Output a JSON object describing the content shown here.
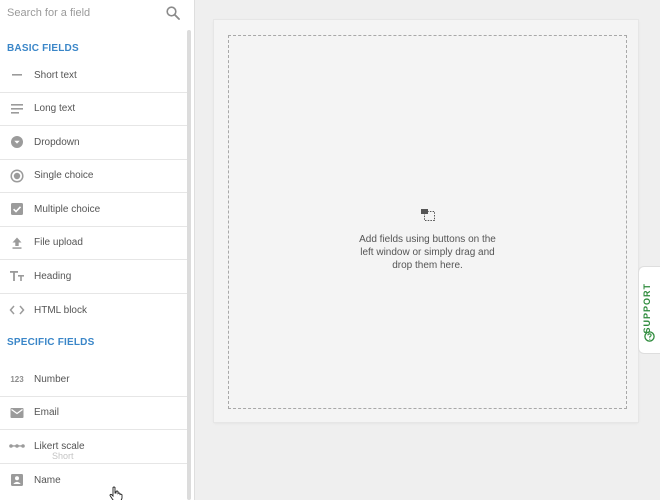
{
  "search": {
    "placeholder": "Search for a field",
    "icon": "search-icon"
  },
  "sections": {
    "basic": "BASIC FIELDS",
    "specific": "SPECIFIC FIELDS"
  },
  "basic_fields": [
    {
      "label": "Short text",
      "icon": "short-text-icon"
    },
    {
      "label": "Long text",
      "icon": "long-text-icon"
    },
    {
      "label": "Dropdown",
      "icon": "dropdown-icon"
    },
    {
      "label": "Single choice",
      "icon": "radio-icon"
    },
    {
      "label": "Multiple choice",
      "icon": "checkbox-icon"
    },
    {
      "label": "File upload",
      "icon": "upload-icon"
    },
    {
      "label": "Heading",
      "icon": "heading-icon"
    },
    {
      "label": "HTML block",
      "icon": "code-icon"
    }
  ],
  "specific_fields": [
    {
      "label": "Number",
      "icon": "number-icon",
      "icon_text": "123"
    },
    {
      "label": "Email",
      "icon": "email-icon"
    },
    {
      "label": "Likert scale",
      "icon": "likert-icon"
    },
    {
      "label": "Name",
      "icon": "person-icon"
    }
  ],
  "drag_ghost_label": "Short",
  "canvas": {
    "empty_message": "Add fields using buttons on the left window or simply drag and drop them here."
  },
  "support": {
    "label": "SUPPORT",
    "icon": "help-circle-icon"
  },
  "colors": {
    "section_title": "#3a86c8",
    "support_green": "#2e8b3c",
    "icon_gray": "#9b9b9b"
  }
}
